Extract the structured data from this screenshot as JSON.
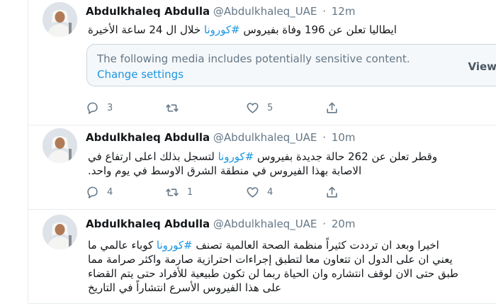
{
  "tweets": [
    {
      "author_name": "Abdulkhaleq Abdulla",
      "handle": "@Abdulkhaleq_UAE",
      "separator": "·",
      "time": "12m",
      "lines": [
        {
          "before": "ايطاليا تعلن عن 196 وفاة بفيروس ",
          "hashtag": "#كورونا",
          "after": " خلال ال 24 ساعة الأخيرة"
        }
      ],
      "media_warning": {
        "text": "The following media includes potentially sensitive content.",
        "link": "Change settings",
        "button": "View"
      },
      "actions": {
        "reply": "3",
        "retweet": "",
        "like": "5"
      }
    },
    {
      "author_name": "Abdulkhaleq Abdulla",
      "handle": "@Abdulkhaleq_UAE",
      "separator": "·",
      "time": "10m",
      "lines": [
        {
          "before": "وقطر تعلن عن 262 حالة جديدة بفيروس ",
          "hashtag": "#كورونا",
          "after": " لتسجل بذلك اعلى ارتفاع في"
        },
        {
          "before": "",
          "hashtag": "",
          "after": "الاصابة بهذا الفيروس في منطقة الشرق الاوسط في يوم واحد."
        }
      ],
      "actions": {
        "reply": "4",
        "retweet": "1",
        "like": "4"
      }
    },
    {
      "author_name": "Abdulkhaleq Abdulla",
      "handle": "@Abdulkhaleq_UAE",
      "separator": "·",
      "time": "20m",
      "lines": [
        {
          "before": "اخيرا وبعد ان ترددت كثيراً منظمة الصحة العالمية تصنف ",
          "hashtag": "#كورونا",
          "after": " كوباء عالمي ما"
        },
        {
          "before": "",
          "hashtag": "",
          "after": "يعني ان على الدول ان تتعاون معا لتطبق إجراءات احترازية  صارمة واكثر صرامة مما"
        },
        {
          "before": "",
          "hashtag": "",
          "after": "طبق حتى الان لوقف انتشاره وان الحياة ربما لن تكون طبيعية للأفراد حتى يتم القضاء"
        },
        {
          "before": "",
          "hashtag": "",
          "after": "على هذا الفيروس الأسرع انتشاراً في التاريخ"
        }
      ]
    }
  ],
  "icons": {
    "reply": "reply-icon",
    "retweet": "retweet-icon",
    "like": "heart-icon",
    "share": "share-icon"
  },
  "colors": {
    "link_blue": "#1b95e0",
    "secondary_text": "#657786",
    "border": "#e6ecf0"
  }
}
